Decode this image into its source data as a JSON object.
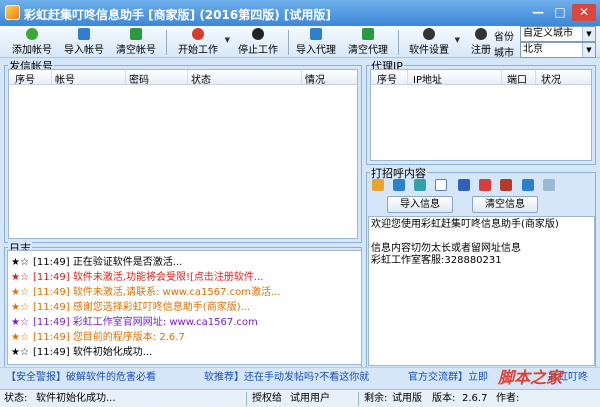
{
  "window": {
    "title": "彩虹赶集叮咚信息助手 [商家版] (2016第四版) [试用版]",
    "minimize": "—",
    "maximize": "□",
    "close": "✕"
  },
  "toolbar": {
    "add_account": "添加帐号",
    "import_account": "导入帐号",
    "clear_account": "清空帐号",
    "start_work": "开始工作",
    "stop_work": "停止工作",
    "import_proxy": "导入代理",
    "clear_proxy": "清空代理",
    "settings": "软件设置",
    "register": "注册",
    "province_label": "省份",
    "province_value": "自定义城市",
    "city_label": "城市",
    "city_value": "北京"
  },
  "accounts": {
    "label": "发信帐号",
    "columns": [
      "序号",
      "帐号",
      "密码",
      "状态",
      "情况"
    ]
  },
  "proxy": {
    "label": "代理IP",
    "columns": [
      "序号",
      "IP地址",
      "端口",
      "状况"
    ]
  },
  "greeting": {
    "label": "打招呼内容",
    "import_button": "导入信息",
    "clear_button": "清空信息",
    "text_lines": [
      "欢迎您使用彩虹赶集叮咚信息助手(商家版)",
      "",
      "信息内容切勿太长或者留网址信息",
      "彩虹工作室客服:328880231"
    ]
  },
  "log": {
    "label": "日志",
    "rows": [
      {
        "time": "[11:49]",
        "text": "正在验证软件是否激活...",
        "color": "#000000"
      },
      {
        "time": "[11:49]",
        "text": "软件未激活,功能将会受限![点击注册软件...",
        "color": "#e02020"
      },
      {
        "time": "[11:49]",
        "text": "软件未激活,请联系: www.ca1567.com激活...",
        "color": "#e07000"
      },
      {
        "time": "[11:49]",
        "text": "感谢您选择彩虹叮咚信息助手(商家版)...",
        "color": "#e07000"
      },
      {
        "time": "[11:49]",
        "text": "彩虹工作室官网网址: www.ca1567.com",
        "color": "#7a1fc7"
      },
      {
        "time": "[11:49]",
        "text": "您目前的程序版本: 2.6.7",
        "color": "#e07000"
      },
      {
        "time": "[11:49]",
        "text": "软件初始化成功...",
        "color": "#000000"
      }
    ]
  },
  "ticker": {
    "part1": "【安全警报】破解软件的危害必看",
    "part2": "软推荐】还在手动发帖吗?不看这你就",
    "part3": "官方交流群】立即",
    "part4": "彩虹叮咚"
  },
  "status": {
    "state_label": "状态:",
    "state_value": "软件初始化成功...",
    "auth_label": "授权给",
    "auth_value": "试用用户",
    "remain_label": "剩余:",
    "remain_value": "试用版",
    "version_label": "版本:",
    "version_value": "2.6.7",
    "author_label": "作者:"
  },
  "watermark": "脚本之家",
  "colors": {
    "accent": "#3d87d6",
    "link": "#1a4fb5",
    "error": "#e02020",
    "warning": "#e07000"
  }
}
